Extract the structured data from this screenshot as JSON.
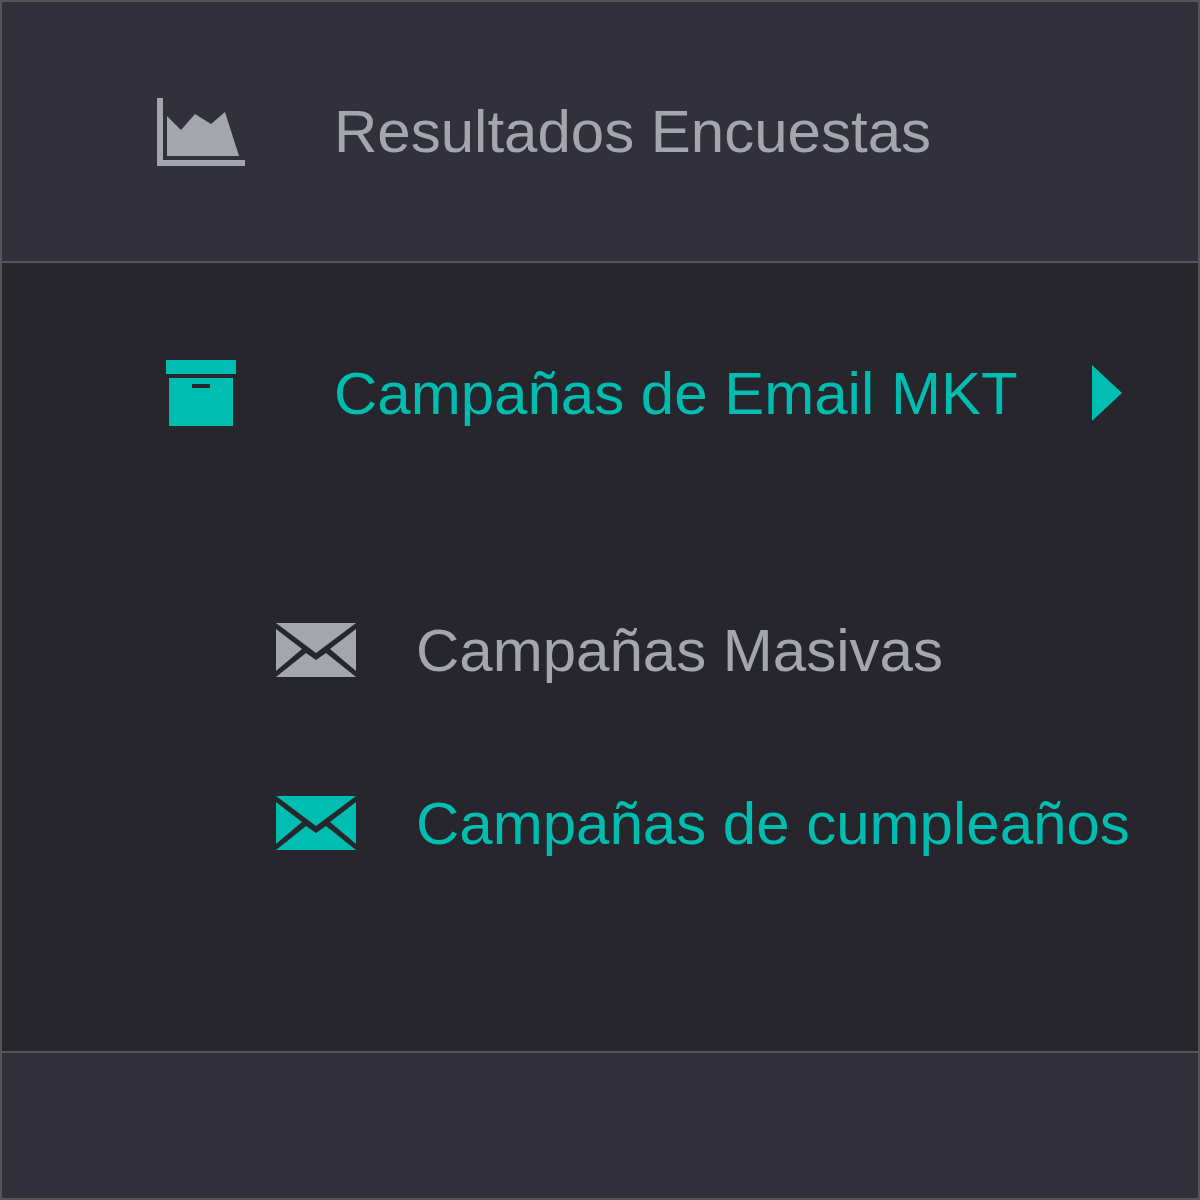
{
  "menu": {
    "items": [
      {
        "label": "Resultados Encuestas",
        "kind": "chart",
        "selected": false,
        "expanded": false
      },
      {
        "label": "Campañas de Email MKT",
        "kind": "archive",
        "selected": true,
        "expanded": true,
        "children": [
          {
            "label": "Campañas Masivas",
            "selected": false
          },
          {
            "label": "Campañas de cumpleaños",
            "selected": true
          }
        ]
      }
    ]
  }
}
